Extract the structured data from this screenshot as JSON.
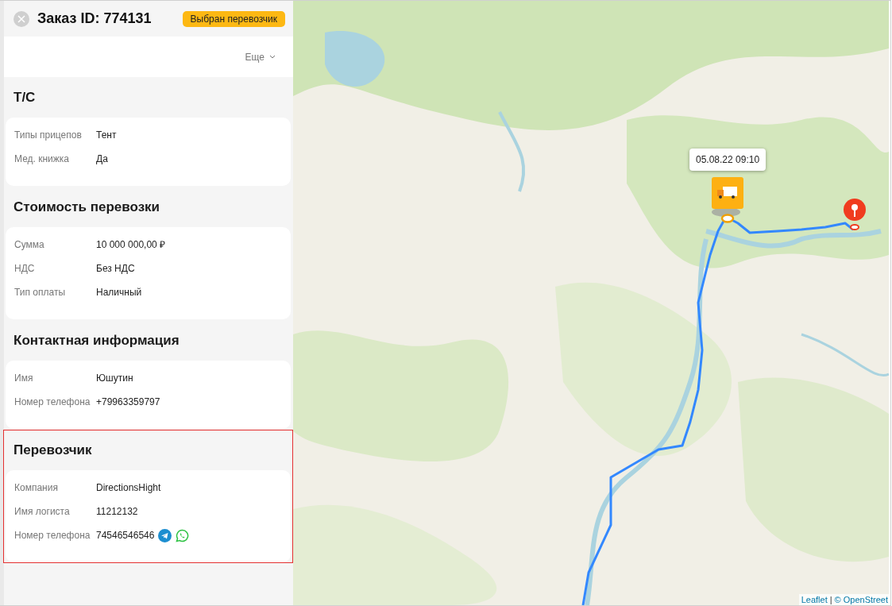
{
  "header": {
    "title": "Заказ ID: 774131",
    "status_badge": "Выбран перевозчик"
  },
  "more_menu": {
    "label": "Еще"
  },
  "sections": [
    {
      "title": "Т/С",
      "highlighted": false,
      "fields": [
        {
          "kind": "text",
          "label": "Типы прицепов",
          "value": "Тент"
        },
        {
          "kind": "text",
          "label": "Мед. книжка",
          "value": "Да"
        }
      ]
    },
    {
      "title": "Стоимость перевозки",
      "highlighted": false,
      "fields": [
        {
          "kind": "text",
          "label": "Сумма",
          "value": "10 000 000,00 ₽"
        },
        {
          "kind": "text",
          "label": "НДС",
          "value": "Без НДС"
        },
        {
          "kind": "text",
          "label": "Тип оплаты",
          "value": "Наличный"
        }
      ]
    },
    {
      "title": "Контактная информация",
      "highlighted": false,
      "fields": [
        {
          "kind": "text",
          "label": "Имя",
          "value": "Юшутин"
        },
        {
          "kind": "text",
          "label": "Номер телефона",
          "value": "+79963359797"
        }
      ]
    },
    {
      "title": "Перевозчик",
      "highlighted": true,
      "fields": [
        {
          "kind": "text",
          "label": "Компания",
          "value": "DirectionsHight"
        },
        {
          "kind": "text",
          "label": "Имя логиста",
          "value": "11212132"
        },
        {
          "kind": "phone",
          "label": "Номер телефона",
          "value": "74546546546"
        }
      ]
    }
  ],
  "map": {
    "tooltip": "05.08.22 09:10",
    "attribution": {
      "link": "Leaflet",
      "separator": "|",
      "text": "© OpenStreet"
    }
  }
}
